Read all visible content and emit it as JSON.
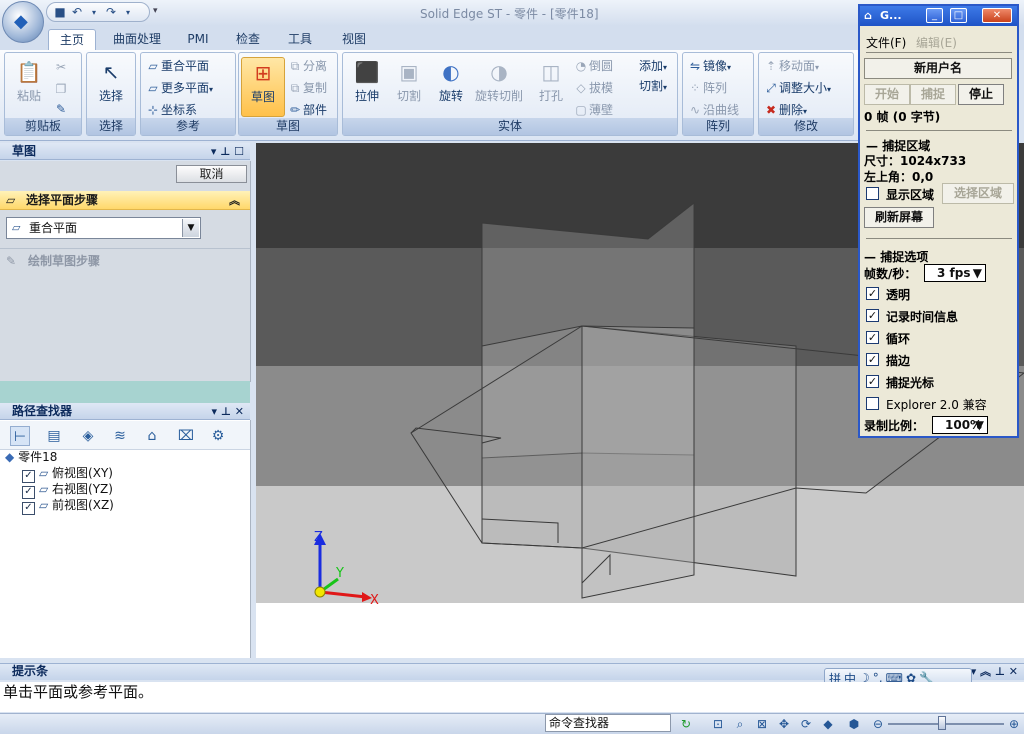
{
  "window": {
    "title": "Solid Edge ST - 零件 - [零件18]"
  },
  "tabs": [
    "主页",
    "曲面处理",
    "PMI",
    "检查",
    "工具",
    "视图"
  ],
  "ribbon": {
    "clipboard": {
      "label": "剪贴板",
      "paste": "粘贴"
    },
    "select": {
      "label": "选择",
      "select": "选择"
    },
    "reference": {
      "label": "参考",
      "coincident_plane": "重合平面",
      "more_planes": "更多平面",
      "coord_system": "坐标系"
    },
    "sketch": {
      "label": "草图",
      "sketch": "草图",
      "separate": "分离",
      "copy": "复制",
      "part": "部件"
    },
    "solid": {
      "label": "实体",
      "extrude": "拉伸",
      "cut": "切割",
      "revolve": "旋转",
      "revolve_cut": "旋转切削",
      "hole": "打孔",
      "round": "倒圆",
      "draft": "拔模",
      "thin_wall": "薄壁",
      "add": "添加",
      "cut_split": "切割"
    },
    "pattern": {
      "label": "阵列",
      "mirror": "镜像",
      "pattern": "阵列",
      "along_curve": "沿曲线"
    },
    "modify": {
      "label": "修改",
      "move_face": "移动面",
      "resize": "调整大小",
      "delete": "删除"
    }
  },
  "sketch_pane": {
    "title": "草图",
    "cancel": "取消",
    "step_title": "选择平面步骤",
    "plane_option": "重合平面",
    "draw_step": "绘制草图步骤"
  },
  "path_finder": {
    "title": "路径查找器",
    "root": "零件18",
    "items": [
      {
        "label": "俯视图(XY)",
        "checked": true
      },
      {
        "label": "右视图(YZ)",
        "checked": true
      },
      {
        "label": "前视图(XZ)",
        "checked": true
      }
    ]
  },
  "axes": {
    "x": "X",
    "y": "Y",
    "z": "Z"
  },
  "prompt": {
    "title": "提示条",
    "text": "单击平面或参考平面。"
  },
  "status": {
    "command_finder": "命令查找器"
  },
  "capture": {
    "title": "G...",
    "menu_file": "文件(F)",
    "menu_edit": "编辑(E)",
    "user": "新用户名",
    "start": "开始",
    "capture": "捕捉",
    "stop": "停止",
    "frames": "0 帧 (0 字节)",
    "region_title": "捕捉区域",
    "size": "尺寸：1024x733",
    "top_left": "左上角：0,0",
    "show_region": "显示区域",
    "select_region": "选择区域",
    "refresh": "刷新屏幕",
    "options_title": "捕捉选项",
    "fps_label": "帧数/秒：",
    "fps_value": "3 fps",
    "opt_transparent": "透明",
    "opt_timestamp": "记录时间信息",
    "opt_loop": "循环",
    "opt_border": "描边",
    "opt_cursor": "捕捉光标",
    "opt_explorer": "Explorer 2.0 兼容",
    "scale_label": "录制比例：",
    "scale_value": "100%"
  }
}
